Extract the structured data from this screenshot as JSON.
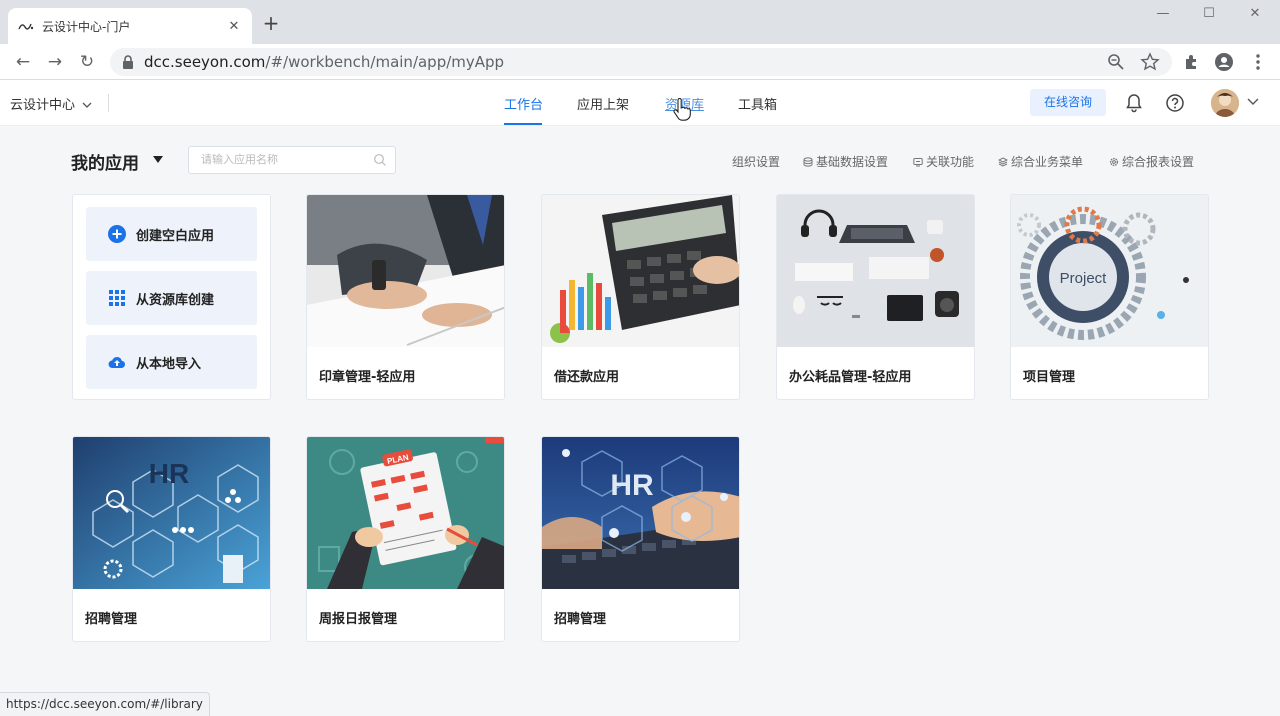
{
  "browser": {
    "tab_title": "云设计中心-门户",
    "tab_close": "✕",
    "new_tab": "+",
    "url_host": "dcc.seeyon.com",
    "url_path": "/#/workbench/main/app/myApp",
    "status_url": "https://dcc.seeyon.com/#/library",
    "window_controls": {
      "minimize": "—",
      "maximize": "☐",
      "close": "✕"
    }
  },
  "header": {
    "brand": "云设计中心",
    "tabs": [
      {
        "label": "工作台",
        "state": "active"
      },
      {
        "label": "应用上架",
        "state": "normal"
      },
      {
        "label": "资源库",
        "state": "hover"
      },
      {
        "label": "工具箱",
        "state": "normal"
      }
    ],
    "consult_label": "在线咨询"
  },
  "main": {
    "title": "我的应用",
    "search_placeholder": "请输入应用名称",
    "links": [
      {
        "label": "组织设置",
        "icon": "none"
      },
      {
        "label": "基础数据设置",
        "icon": "database-icon"
      },
      {
        "label": "关联功能",
        "icon": "link-icon"
      },
      {
        "label": "综合业务菜单",
        "icon": "layers-icon"
      },
      {
        "label": "综合报表设置",
        "icon": "gear-icon"
      }
    ],
    "actions": [
      {
        "label": "创建空白应用",
        "icon": "plus-circle-icon"
      },
      {
        "label": "从资源库创建",
        "icon": "grid-icon"
      },
      {
        "label": "从本地导入",
        "icon": "cloud-upload-icon"
      }
    ],
    "apps": [
      {
        "title": "印章管理-轻应用",
        "image": "stamp-signing-photo"
      },
      {
        "title": "借还款应用",
        "image": "calculator-finance-photo"
      },
      {
        "title": "办公耗品管理-轻应用",
        "image": "office-supplies-photo"
      },
      {
        "title": "项目管理",
        "image": "project-gears-illustration",
        "image_text": "Project"
      },
      {
        "title": "招聘管理",
        "image": "hr-hexagon-illustration",
        "image_text": "HR"
      },
      {
        "title": "周报日报管理",
        "image": "plan-clipboard-illustration",
        "image_text": "PLAN"
      },
      {
        "title": "招聘管理",
        "image": "hr-keyboard-photo",
        "image_text": "HR"
      }
    ]
  },
  "colors": {
    "accent": "#1a73e8",
    "consult_bg": "#e8f1fd",
    "action_bg": "#eef2fa"
  }
}
